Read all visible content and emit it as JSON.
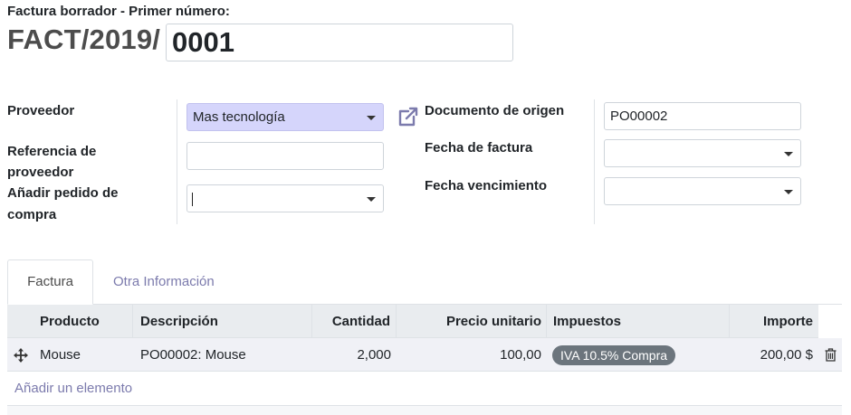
{
  "header": {
    "subtitle": "Factura borrador - Primer número:",
    "prefix": "FACT/2019/",
    "number": "0001"
  },
  "form": {
    "proveedor_label": "Proveedor",
    "proveedor_value": "Mas tecnología",
    "referencia_label_line1": "Referencia de",
    "referencia_label_line2": "proveedor",
    "referencia_value": "",
    "pedido_label_line1": "Añadir pedido de",
    "pedido_label_line2": "compra",
    "pedido_value": "",
    "documento_label": "Documento de origen",
    "documento_value": "PO00002",
    "fecha_factura_label": "Fecha de factura",
    "fecha_factura_value": "",
    "fecha_vencimiento_label": "Fecha vencimiento",
    "fecha_vencimiento_value": ""
  },
  "tabs": [
    {
      "label": "Factura",
      "active": true
    },
    {
      "label": "Otra Información",
      "active": false
    }
  ],
  "table": {
    "columns": [
      "Producto",
      "Descripción",
      "Cantidad",
      "Precio unitario",
      "Impuestos",
      "Importe"
    ],
    "rows": [
      {
        "producto": "Mouse",
        "descripcion": "PO00002: Mouse",
        "cantidad": "2,000",
        "precio": "100,00",
        "impuesto": "IVA 10.5% Compra",
        "importe": "200,00 $"
      }
    ],
    "add_line": "Añadir un elemento"
  },
  "colors": {
    "highlight_field": "#d5d5fb",
    "link": "#7c7bad",
    "badge": "#6c757d",
    "header_bg": "#e9ecef",
    "row_bg": "#f0f1f6"
  },
  "icons": [
    "external-link-icon",
    "move-handle-icon",
    "trash-icon",
    "dropdown-caret-icon"
  ]
}
